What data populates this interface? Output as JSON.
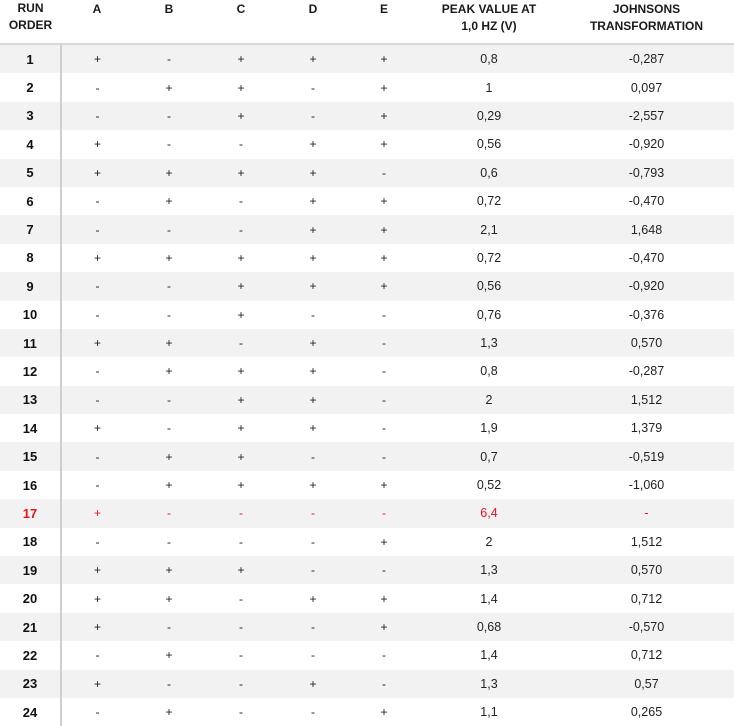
{
  "table": {
    "headers": {
      "run_order": [
        "RUN",
        "ORDER"
      ],
      "a": "A",
      "b": "B",
      "c": "C",
      "d": "D",
      "e": "E",
      "peak": [
        "PEAK VALUE AT",
        "1,0 HZ (V)"
      ],
      "johnson": [
        "JOHNSONS",
        "TRANSFORMATION"
      ]
    },
    "highlight_color": "#e8141c",
    "rows": [
      {
        "run": "1",
        "a": "+",
        "b": "-",
        "c": "+",
        "d": "+",
        "e": "+",
        "peak": "0,8",
        "johnson": "-0,287"
      },
      {
        "run": "2",
        "a": "-",
        "b": "+",
        "c": "+",
        "d": "-",
        "e": "+",
        "peak": "1",
        "johnson": "0,097"
      },
      {
        "run": "3",
        "a": "-",
        "b": "-",
        "c": "+",
        "d": "-",
        "e": "+",
        "peak": "0,29",
        "johnson": "-2,557"
      },
      {
        "run": "4",
        "a": "+",
        "b": "-",
        "c": "-",
        "d": "+",
        "e": "+",
        "peak": "0,56",
        "johnson": "-0,920"
      },
      {
        "run": "5",
        "a": "+",
        "b": "+",
        "c": "+",
        "d": "+",
        "e": "-",
        "peak": "0,6",
        "johnson": "-0,793"
      },
      {
        "run": "6",
        "a": "-",
        "b": "+",
        "c": "-",
        "d": "+",
        "e": "+",
        "peak": "0,72",
        "johnson": "-0,470"
      },
      {
        "run": "7",
        "a": "-",
        "b": "-",
        "c": "-",
        "d": "+",
        "e": "+",
        "peak": "2,1",
        "johnson": "1,648"
      },
      {
        "run": "8",
        "a": "+",
        "b": "+",
        "c": "+",
        "d": "+",
        "e": "+",
        "peak": "0,72",
        "johnson": "-0,470"
      },
      {
        "run": "9",
        "a": "-",
        "b": "-",
        "c": "+",
        "d": "+",
        "e": "+",
        "peak": "0,56",
        "johnson": "-0,920"
      },
      {
        "run": "10",
        "a": "-",
        "b": "-",
        "c": "+",
        "d": "-",
        "e": "-",
        "peak": "0,76",
        "johnson": "-0,376"
      },
      {
        "run": "11",
        "a": "+",
        "b": "+",
        "c": "-",
        "d": "+",
        "e": "-",
        "peak": "1,3",
        "johnson": "0,570"
      },
      {
        "run": "12",
        "a": "-",
        "b": "+",
        "c": "+",
        "d": "+",
        "e": "-",
        "peak": "0,8",
        "johnson": "-0,287"
      },
      {
        "run": "13",
        "a": "-",
        "b": "-",
        "c": "+",
        "d": "+",
        "e": "-",
        "peak": "2",
        "johnson": "1,512"
      },
      {
        "run": "14",
        "a": "+",
        "b": "-",
        "c": "+",
        "d": "+",
        "e": "-",
        "peak": "1,9",
        "johnson": "1,379"
      },
      {
        "run": "15",
        "a": "-",
        "b": "+",
        "c": "+",
        "d": "-",
        "e": "-",
        "peak": "0,7",
        "johnson": "-0,519"
      },
      {
        "run": "16",
        "a": "-",
        "b": "+",
        "c": "+",
        "d": "+",
        "e": "+",
        "peak": "0,52",
        "johnson": "-1,060"
      },
      {
        "run": "17",
        "a": "+",
        "b": "-",
        "c": "-",
        "d": "-",
        "e": "-",
        "peak": "6,4",
        "johnson": "-",
        "highlighted": true
      },
      {
        "run": "18",
        "a": "-",
        "b": "-",
        "c": "-",
        "d": "-",
        "e": "+",
        "peak": "2",
        "johnson": "1,512"
      },
      {
        "run": "19",
        "a": "+",
        "b": "+",
        "c": "+",
        "d": "-",
        "e": "-",
        "peak": "1,3",
        "johnson": "0,570"
      },
      {
        "run": "20",
        "a": "+",
        "b": "+",
        "c": "-",
        "d": "+",
        "e": "+",
        "peak": "1,4",
        "johnson": "0,712"
      },
      {
        "run": "21",
        "a": "+",
        "b": "-",
        "c": "-",
        "d": "-",
        "e": "+",
        "peak": "0,68",
        "johnson": "-0,570"
      },
      {
        "run": "22",
        "a": "-",
        "b": "+",
        "c": "-",
        "d": "-",
        "e": "-",
        "peak": "1,4",
        "johnson": "0,712"
      },
      {
        "run": "23",
        "a": "+",
        "b": "-",
        "c": "-",
        "d": "+",
        "e": "-",
        "peak": "1,3",
        "johnson": "0,57"
      },
      {
        "run": "24",
        "a": "-",
        "b": "+",
        "c": "-",
        "d": "-",
        "e": "+",
        "peak": "1,1",
        "johnson": "0,265"
      }
    ]
  }
}
